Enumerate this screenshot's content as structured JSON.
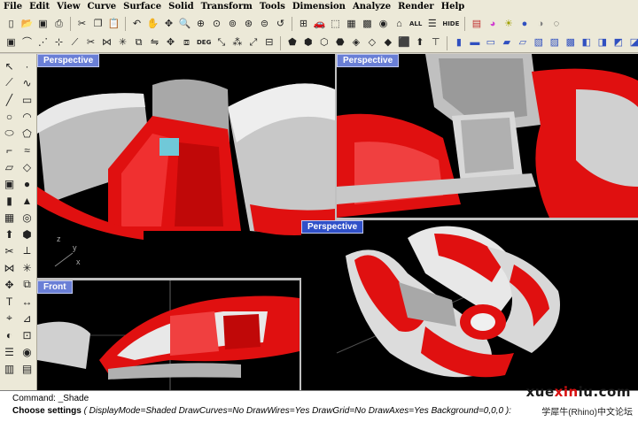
{
  "menu": [
    "File",
    "Edit",
    "View",
    "Curve",
    "Surface",
    "Solid",
    "Transform",
    "Tools",
    "Dimension",
    "Analyze",
    "Render",
    "Help"
  ],
  "toolbar": {
    "all_label": "ALL",
    "hide_label": "HIDE",
    "deg_label": "DEG"
  },
  "viewports": {
    "top_left": {
      "label": "Perspective"
    },
    "top_right": {
      "label": "Perspective"
    },
    "bottom_left": {
      "label": "Front"
    },
    "bottom_right": {
      "label": "Perspective"
    }
  },
  "axes": {
    "x": "x",
    "y": "y",
    "z": "z"
  },
  "command": {
    "line1": "Command: _Shade",
    "prompt": "Choose settings",
    "options": "( DisplayMode=Shaded  DrawCurves=No  DrawWires=Yes  DrawGrid=No  DrawAxes=Yes  Background=0,0,0 ):"
  },
  "watermark": {
    "site_a": "xue",
    "site_b": "xin",
    "site_c": "iu.com",
    "forum": "学犀牛(Rhino)中文论坛"
  },
  "colors": {
    "viewport_bg": "#000000",
    "model_red": "#e01010",
    "model_white": "#e8e8e8",
    "label_bg": "#6a7fd6"
  }
}
